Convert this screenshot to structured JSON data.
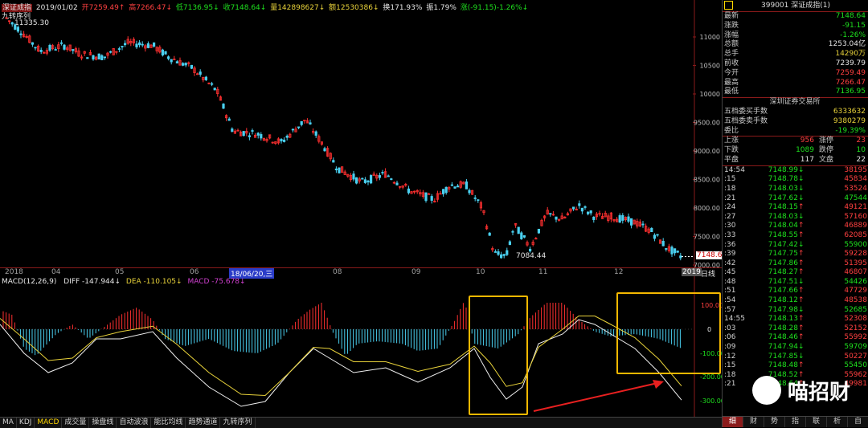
{
  "header": {
    "name": "深证成指",
    "date": "2019/01/02",
    "open": "开7259.49↑",
    "high": "高7266.47↓",
    "low": "低7136.95↓",
    "close": "收7148.64↓",
    "volume": "量142898627↓",
    "amount": "额12530386↓",
    "turnover": "换171.93%",
    "amplitude": "振1.79%",
    "change": "涨(-91.15)-1.26%↓",
    "indicator": "九转序列",
    "high_mark": "11335.30",
    "low_mark": "7084.44",
    "last_price_tag": "7148.64"
  },
  "price_axis": [
    "11000",
    "10500",
    "10000",
    "9500.00",
    "9000.00",
    "8500.00",
    "8000.00",
    "7500.00",
    "7000.00"
  ],
  "date_axis": [
    "2018",
    "04",
    "05",
    "06",
    "18/06/20,三",
    "08",
    "09",
    "10",
    "11",
    "12",
    "2019"
  ],
  "period_label": "日线",
  "macd": {
    "title": "MACD(12,26,9)",
    "diff": "DIFF -147.944↓",
    "dea": "DEA -110.105↓",
    "macd": "MACD -75.678↓",
    "axis": [
      "100.00",
      "0",
      "-100.00",
      "-200.00",
      "-300.00"
    ]
  },
  "bottom_tabs": [
    "MA",
    "KDJ",
    "MACD",
    "成交量",
    "操盘线",
    "自动波浪",
    "能比均线",
    "趋势通道",
    "九转序列"
  ],
  "side": {
    "code_name": "399001 深证成指(1)",
    "quotes": [
      {
        "label": "最新",
        "value": "7148.64",
        "color": "#1ee01e"
      },
      {
        "label": "涨跌",
        "value": "-91.15",
        "color": "#1ee01e"
      },
      {
        "label": "涨幅",
        "value": "-1.26%",
        "color": "#1ee01e"
      },
      {
        "label": "总额",
        "value": "1253.04亿",
        "color": "#e6e6e6"
      },
      {
        "label": "总手",
        "value": "14290万",
        "color": "#e8d23a"
      },
      {
        "label": "前收",
        "value": "7239.79",
        "color": "#e6e6e6"
      },
      {
        "label": "今开",
        "value": "7259.49",
        "color": "#ff4040"
      },
      {
        "label": "最高",
        "value": "7266.47",
        "color": "#ff4040"
      },
      {
        "label": "最低",
        "value": "7136.95",
        "color": "#1ee01e"
      }
    ],
    "exchange": "深圳证券交易所",
    "orders": [
      {
        "label": "五档委买手数",
        "value": "6333632",
        "color": "#e8d23a"
      },
      {
        "label": "五档委卖手数",
        "value": "9380279",
        "color": "#e8d23a"
      },
      {
        "label": "委比",
        "value": "-19.39%",
        "color": "#1ee01e"
      }
    ],
    "breadth": [
      {
        "l1": "上涨",
        "v1": "956",
        "l2": "涨停",
        "v2": "23",
        "c": "#ff4040"
      },
      {
        "l1": "下跌",
        "v1": "1089",
        "l2": "跌停",
        "v2": "10",
        "c": "#1ee01e"
      },
      {
        "l1": "平盘",
        "v1": "117",
        "l2": "文盘",
        "v2": "22",
        "c": "#e6e6e6"
      }
    ],
    "ticks": [
      {
        "t": "14:54",
        "p": "7148.99",
        "a": "↓",
        "v": "38195",
        "g": false
      },
      {
        "t": ":15",
        "p": "7148.78",
        "a": "↓",
        "v": "45834",
        "g": false
      },
      {
        "t": ":18",
        "p": "7148.03",
        "a": "↓",
        "v": "53524",
        "g": false
      },
      {
        "t": ":21",
        "p": "7147.62",
        "a": "↓",
        "v": "47544",
        "g": true
      },
      {
        "t": ":24",
        "p": "7148.15",
        "a": "↑",
        "v": "49121",
        "g": false
      },
      {
        "t": ":27",
        "p": "7148.03",
        "a": "↓",
        "v": "57160",
        "g": false
      },
      {
        "t": ":30",
        "p": "7148.04",
        "a": "↑",
        "v": "46889",
        "g": false
      },
      {
        "t": ":33",
        "p": "7148.55",
        "a": "↑",
        "v": "62085",
        "g": false
      },
      {
        "t": ":36",
        "p": "7147.42",
        "a": "↓",
        "v": "55900",
        "g": true
      },
      {
        "t": ":39",
        "p": "7147.75",
        "a": "↑",
        "v": "59228",
        "g": false
      },
      {
        "t": ":42",
        "p": "7147.86",
        "a": "↑",
        "v": "51395",
        "g": false
      },
      {
        "t": ":45",
        "p": "7148.27",
        "a": "↑",
        "v": "46807",
        "g": false
      },
      {
        "t": ":48",
        "p": "7147.51",
        "a": "↓",
        "v": "54426",
        "g": true
      },
      {
        "t": ":51",
        "p": "7147.66",
        "a": "↑",
        "v": "47729",
        "g": false
      },
      {
        "t": ":54",
        "p": "7148.12",
        "a": "↑",
        "v": "48538",
        "g": false
      },
      {
        "t": ":57",
        "p": "7147.98",
        "a": "↓",
        "v": "52685",
        "g": true
      },
      {
        "t": "14:55",
        "p": "7148.13",
        "a": "↑",
        "v": "52308",
        "g": false
      },
      {
        "t": ":03",
        "p": "7148.28",
        "a": "↑",
        "v": "52152",
        "g": false
      },
      {
        "t": ":06",
        "p": "7148.46",
        "a": "↑",
        "v": "55992",
        "g": false
      },
      {
        "t": ":09",
        "p": "7147.94",
        "a": "↓",
        "v": "59709",
        "g": true
      },
      {
        "t": ":12",
        "p": "7147.85",
        "a": "↓",
        "v": "50227",
        "g": false
      },
      {
        "t": ":15",
        "p": "7148.48",
        "a": "↑",
        "v": "55450",
        "g": true
      },
      {
        "t": ":18",
        "p": "7148.52",
        "a": "↑",
        "v": "55962",
        "g": false
      },
      {
        "t": ":21",
        "p": "7148.64",
        "a": "↑",
        "v": "49981",
        "g": false
      }
    ],
    "tabs": [
      "细",
      "财",
      "势",
      "指",
      "联",
      "析",
      "自"
    ]
  },
  "watermark": "喵招财",
  "colors": {
    "up": "#ff4040",
    "down": "#1ee01e",
    "box": "#f5b800",
    "arrow": "#e82020"
  }
}
